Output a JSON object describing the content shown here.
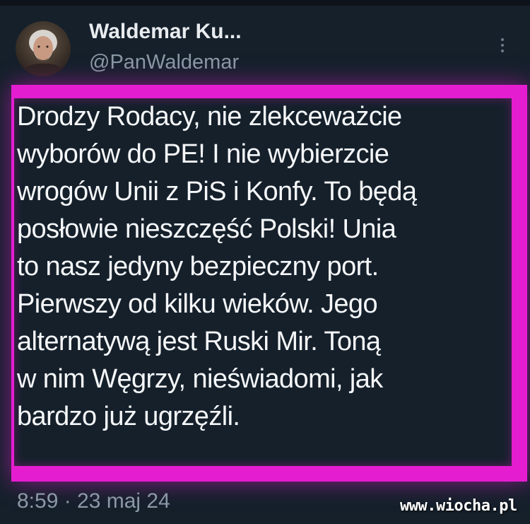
{
  "tweet": {
    "author": {
      "display_name": "Waldemar Ku...",
      "handle": "@PanWaldemar",
      "avatar_icon": "profile-photo"
    },
    "more_icon": "more-vertical-icon",
    "text_lines": [
      "Drodzy Rodacy, nie zlekceważcie",
      "wyborów do PE! I nie wybierzcie",
      "wrogów Unii z PiS i Konfy. To będą",
      "posłowie nieszczęść Polski! Unia",
      "to nasz jedyny bezpieczny port.",
      "Pierwszy od kilku wieków. Jego",
      "alternatywą jest Ruski Mir. Toną",
      "w nim Węgrzy, nieświadomi, jak",
      "bardzo już ugrzęźli."
    ],
    "timestamp": "8:59 · 23 maj 24"
  },
  "watermark": "www.wiocha.pl",
  "colors": {
    "background": "#15202b",
    "highlight_border": "#e51dd1",
    "text_primary": "#f5f7f9",
    "text_secondary": "#8b98a5"
  }
}
